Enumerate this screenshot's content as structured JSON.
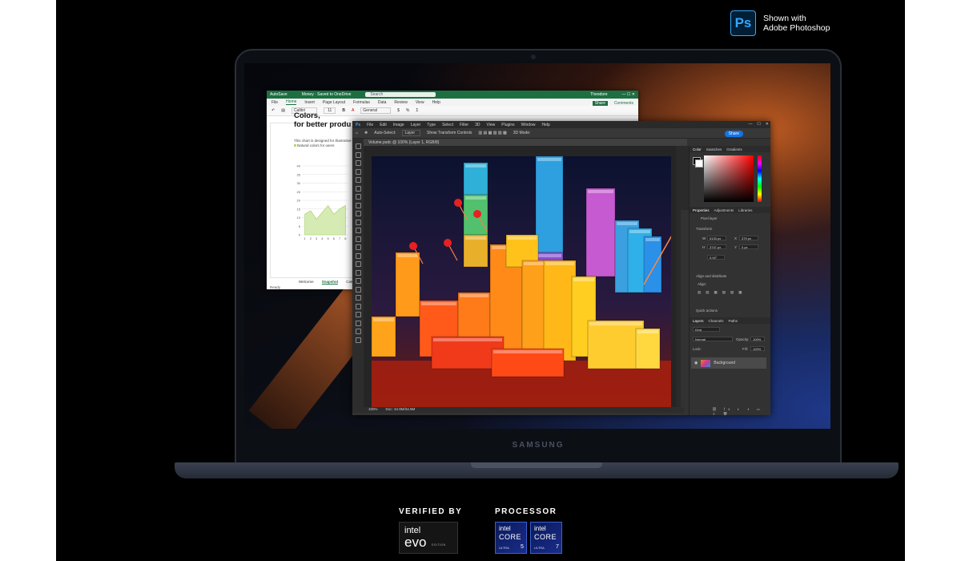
{
  "badge": {
    "logo": "Ps",
    "line1": "Shown with",
    "line2": "Adobe Photoshop"
  },
  "laptop": {
    "brand": "SAMSUNG"
  },
  "excel": {
    "autosave": "AutoSave",
    "file_title": "Money · Saved to OneDrive",
    "search_placeholder": "Search",
    "user": "Theodore",
    "menu": [
      "File",
      "Home",
      "Insert",
      "Page Layout",
      "Formulas",
      "Data",
      "Review",
      "View",
      "Help"
    ],
    "active_menu": "Home",
    "share": "Share",
    "comments": "Comments",
    "font": "Calibri",
    "font_size": "11",
    "number_format": "General",
    "heading_line1": "Colors,",
    "heading_line2": "for better produ",
    "caption": "This chart is designed for illustrative p",
    "legend": "Natural colors for users",
    "chart_data": {
      "type": "area",
      "x": [
        1,
        2,
        3,
        4,
        5,
        6,
        7,
        8
      ],
      "y_ticks": [
        0,
        5,
        10,
        15,
        20,
        25,
        30,
        35,
        40
      ],
      "ylim": [
        0,
        40
      ],
      "series": [
        {
          "name": "Natural colors for users",
          "values": [
            12,
            14,
            9,
            13,
            17,
            12,
            15,
            17
          ]
        }
      ]
    },
    "sheet_tabs": [
      "Welcome",
      "Snapshot",
      "Categories"
    ],
    "active_tab": "Snapshot",
    "status": "Ready"
  },
  "photoshop": {
    "menu": [
      "File",
      "Edit",
      "Image",
      "Layer",
      "Type",
      "Select",
      "Filter",
      "3D",
      "View",
      "Plugins",
      "Window",
      "Help"
    ],
    "options": {
      "autoselect": "Auto-Select:",
      "layer": "Layer",
      "transform": "Show Transform Controls",
      "mode3d": "3D Mode:",
      "share": "Share"
    },
    "doc_tab": "Volume.psdc @ 100% (Layer 1, RGB/8)",
    "zoom": "100%",
    "doc_size": "Doc: 34.9M/34.9M",
    "panels": {
      "color_tabs": [
        "Color",
        "Swatches",
        "Gradients"
      ],
      "prop_tabs": [
        "Properties",
        "Adjustments",
        "Libraries"
      ],
      "pixel_layer": "Pixel layer",
      "transform": "Transform",
      "w_label": "W",
      "w_value": "5133 px",
      "x_label": "X",
      "x_value": "379 px",
      "h_label": "H",
      "h_value": "3747 px",
      "y_label": "Y",
      "y_value": "0 px",
      "angle": "0.00°",
      "align_title": "Align and distribute",
      "align_label": "Align:",
      "quick_actions": "Quick actions",
      "layer_tabs": [
        "Layers",
        "Channels",
        "Paths"
      ],
      "kind": "Kind",
      "blend": "Normal",
      "opacity_label": "Opacity:",
      "opacity_value": "100%",
      "lock_label": "Lock:",
      "fill_label": "Fill:",
      "fill_value": "100%",
      "layer_name": "Background"
    }
  },
  "footer": {
    "verified_by": "VERIFIED BY",
    "processor": "PROCESSOR",
    "evo_intel": "intel",
    "evo_text": "evo",
    "evo_edition": "EDITION",
    "core_intel": "intel",
    "core_text": "CORE",
    "core_ultra": "ULTRA",
    "core_5": "5",
    "core_7": "7"
  }
}
